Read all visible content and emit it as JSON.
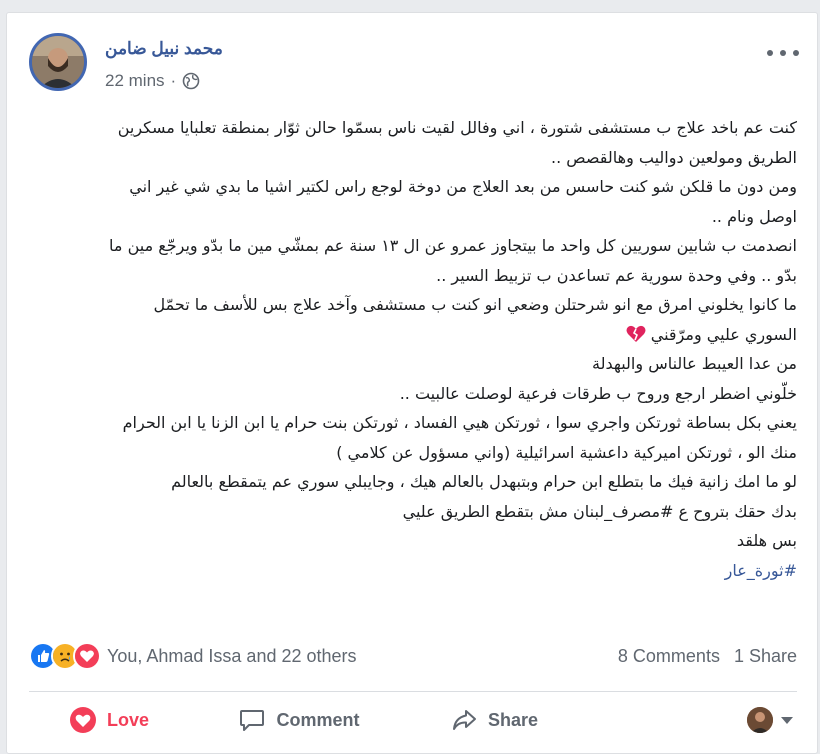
{
  "post": {
    "author": "محمد نبيل ضامن",
    "time": "22 mins",
    "separator": "·",
    "privacy_icon": "globe-icon",
    "lines": [
      "كنت عم باخد علاج ب مستشفى شتورة ، اني وفالل لقيت ناس بسمّوا حالن ثوّار بمنطقة تعلبايا مسكرين",
      "الطريق ومولعين دواليب وهالقصص ..",
      "ومن دون ما قلكن شو كنت حاسس من بعد العلاج من دوخة لوجع راس لكتير اشيا ما بدي شي غير اني",
      "اوصل ونام ..",
      "انصدمت ب شابين سوريين كل واحد ما بيتجاوز عمرو عن ال ١٣ سنة عم بمشّي مين ما بدّو ويرجّع مين ما",
      "بدّو .. وفي وحدة سورية عم تساعدن ب تزبيط السير ..",
      "ما كانوا يخلوني امرق مع انو شرحتلن وضعي انو كنت ب مستشفى وآخد علاج بس للأسف ما تحمّل",
      "السوري عليي ومرّقني",
      "من عدا العيبط عالناس والبهدلة",
      "خلّوني اضطر ارجع وروح ب طرقات فرعية لوصلت عالبيت ..",
      "يعني بكل بساطة ثورتكن واجري سوا ، ثورتكن هيي الفساد ، ثورتكن بنت حرام يا ابن الزنا يا ابن الحرام",
      "منك الو ، ثورتكن اميركية داعشية اسرائيلية (واني مسؤول عن كلامي )",
      "لو ما امك زانية فيك ما بتطلع ابن حرام وبتبهدل بالعالم هيك ، وجايبلي سوري عم يتمقطع بالعالم",
      "بدك حقك بتروح ع #مصرف_لبنان مش بتقطع الطريق عليي",
      "بس هلقد"
    ],
    "hashtag_line": "#ثورة_عار",
    "broken_heart_icon": "broken-heart-icon"
  },
  "reactions": {
    "icons": [
      "like-icon",
      "sad-icon",
      "love-icon"
    ],
    "names": "You, Ahmad Issa and 22 others",
    "comments": "8 Comments",
    "shares": "1 Share"
  },
  "actions": {
    "love_label": "Love",
    "comment_label": "Comment",
    "share_label": "Share"
  },
  "colors": {
    "love": "#f33e58",
    "link": "#385898",
    "muted": "#606770",
    "like_blue": "#1877f2"
  }
}
